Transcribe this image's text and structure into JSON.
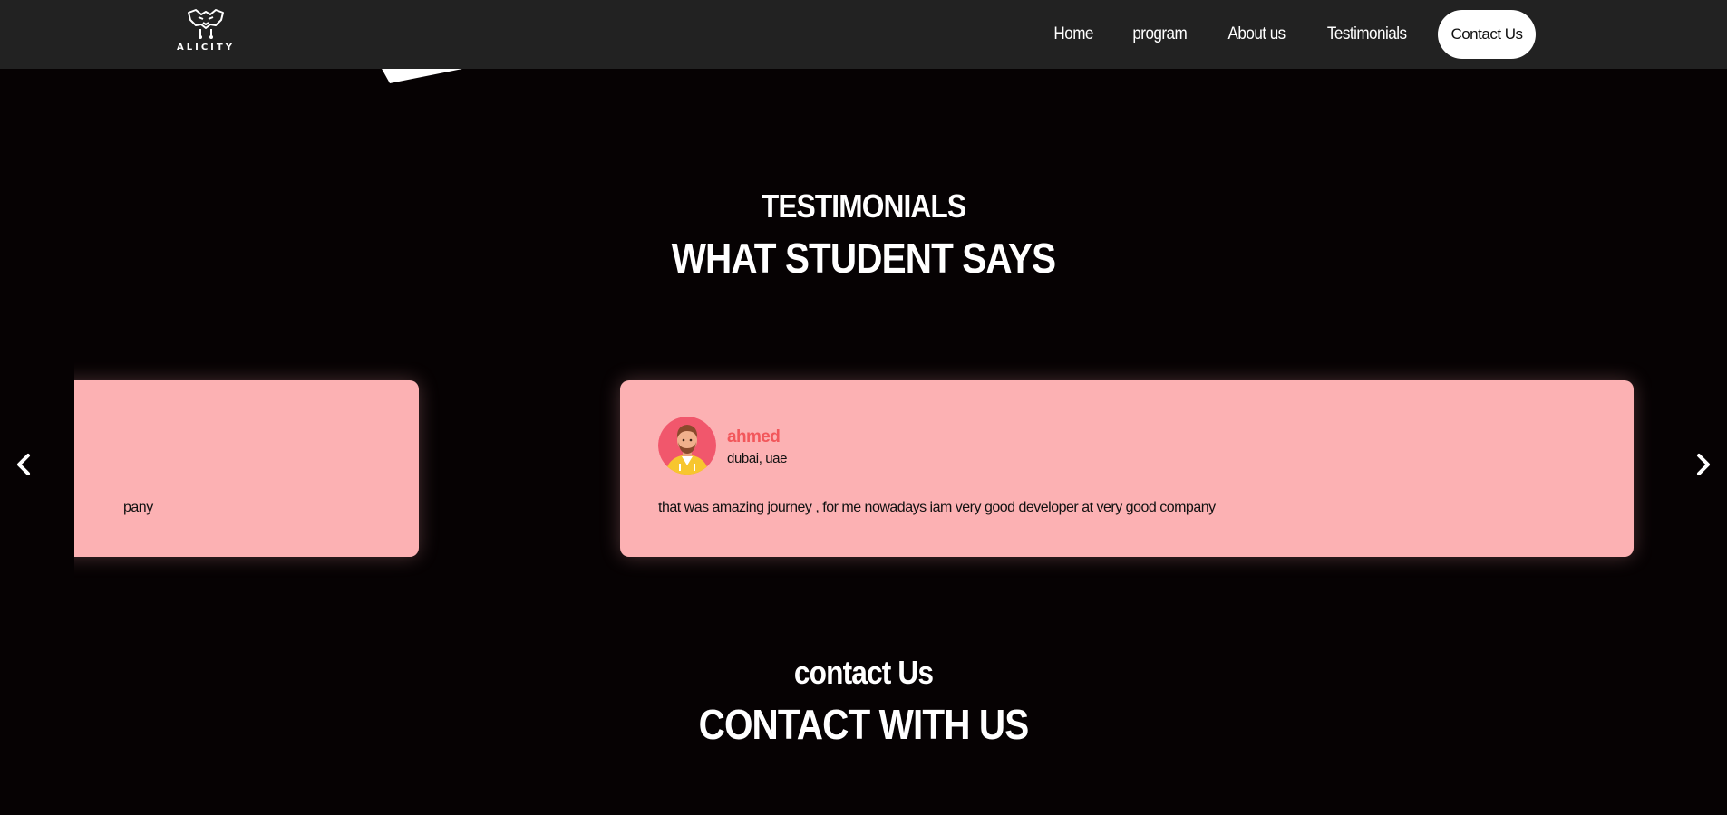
{
  "header": {
    "logo_text": "ALICITY",
    "nav": [
      {
        "label": "Home"
      },
      {
        "label": "program"
      },
      {
        "label": "About us"
      },
      {
        "label": "Testimonials"
      }
    ],
    "contact_button_label": "Contact Us"
  },
  "testimonials": {
    "eyebrow": "TESTIMONIALS",
    "title": "WHAT STUDENT SAYS",
    "prev_icon": "chevron-left-icon",
    "next_icon": "chevron-right-icon",
    "cards": [
      {
        "name": "",
        "location": "",
        "quote_visible": "pany"
      },
      {
        "name": "ahmed",
        "location": "dubai, uae",
        "quote": "that was amazing journey , for me nowadays iam very good developer at very good company",
        "avatar_icon": "male-student-avatar"
      }
    ]
  },
  "contact": {
    "eyebrow": "contact Us",
    "title": "CONTACT WITH US"
  },
  "colors": {
    "page_background": "#060203",
    "header_background": "#222222",
    "card_background": "#fcb1b3",
    "name_accent": "#f2575b",
    "button_background": "#ffffff"
  }
}
